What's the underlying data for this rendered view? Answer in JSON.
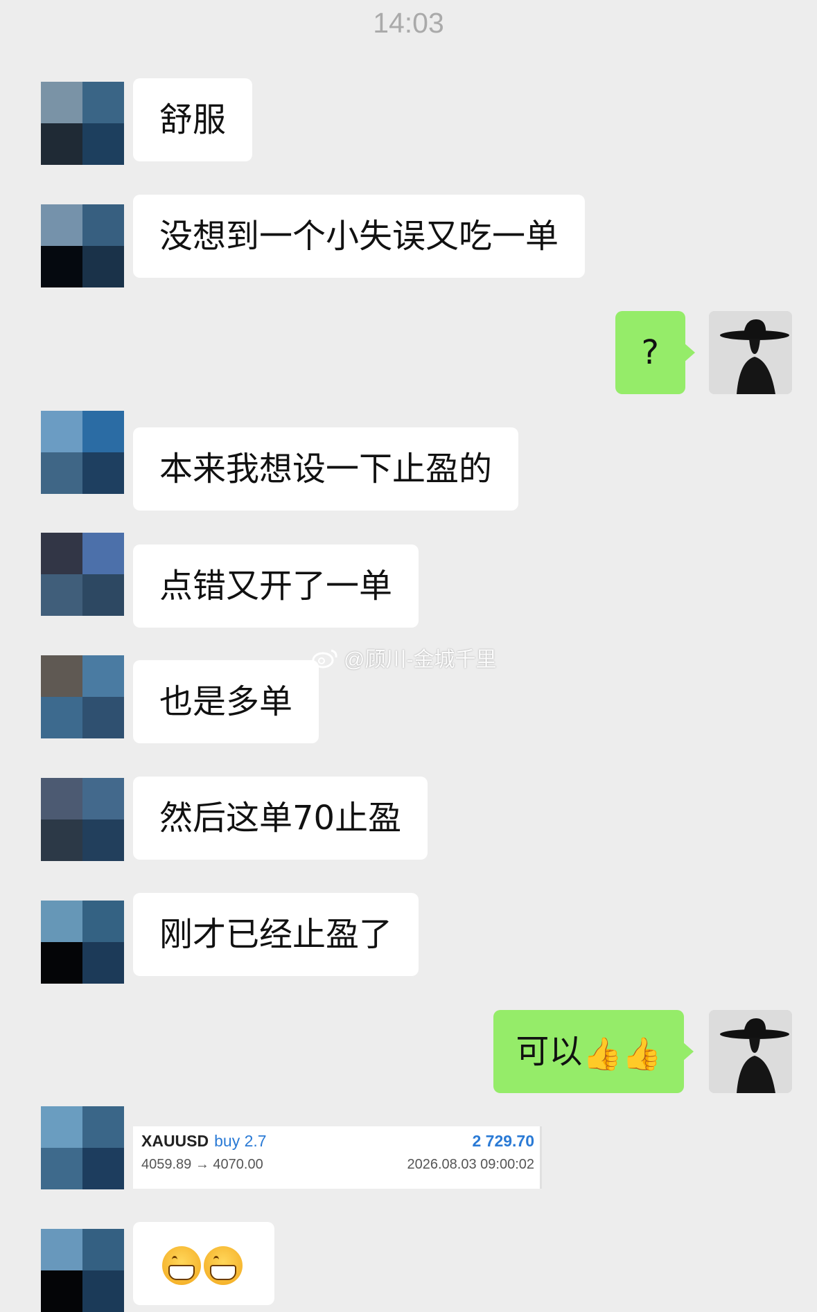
{
  "status": {
    "time": "14:03"
  },
  "watermark": {
    "text": "@顾川-金城千里"
  },
  "messages": [
    {
      "side": "left",
      "text": "舒服"
    },
    {
      "side": "left",
      "text": "没想到一个小失误又吃一单"
    },
    {
      "side": "right",
      "text": "?"
    },
    {
      "side": "left",
      "text": "本来我想设一下止盈的"
    },
    {
      "side": "left",
      "text": "点错又开了一单"
    },
    {
      "side": "left",
      "text": "也是多单"
    },
    {
      "side": "left",
      "text": "然后这单70止盈"
    },
    {
      "side": "left",
      "text": "刚才已经止盈了"
    },
    {
      "side": "right",
      "text": "可以",
      "emojis": [
        "thumbs-up",
        "thumbs-up"
      ]
    },
    {
      "side": "left",
      "type": "trade-screenshot"
    },
    {
      "side": "left",
      "type": "emoji",
      "emojis": [
        "grinning-face",
        "grinning-face"
      ]
    }
  ],
  "trade": {
    "symbol": "XAUUSD",
    "side": "buy 2.7",
    "profit": "2 729.70",
    "prices": "4059.89 → 4070.00",
    "timestamp": "2026.08.03 09:00:02"
  },
  "colors": {
    "background": "#ededed",
    "bubble_left": "#ffffff",
    "bubble_right": "#95ec69",
    "trade_blue": "#2a7ad5"
  }
}
